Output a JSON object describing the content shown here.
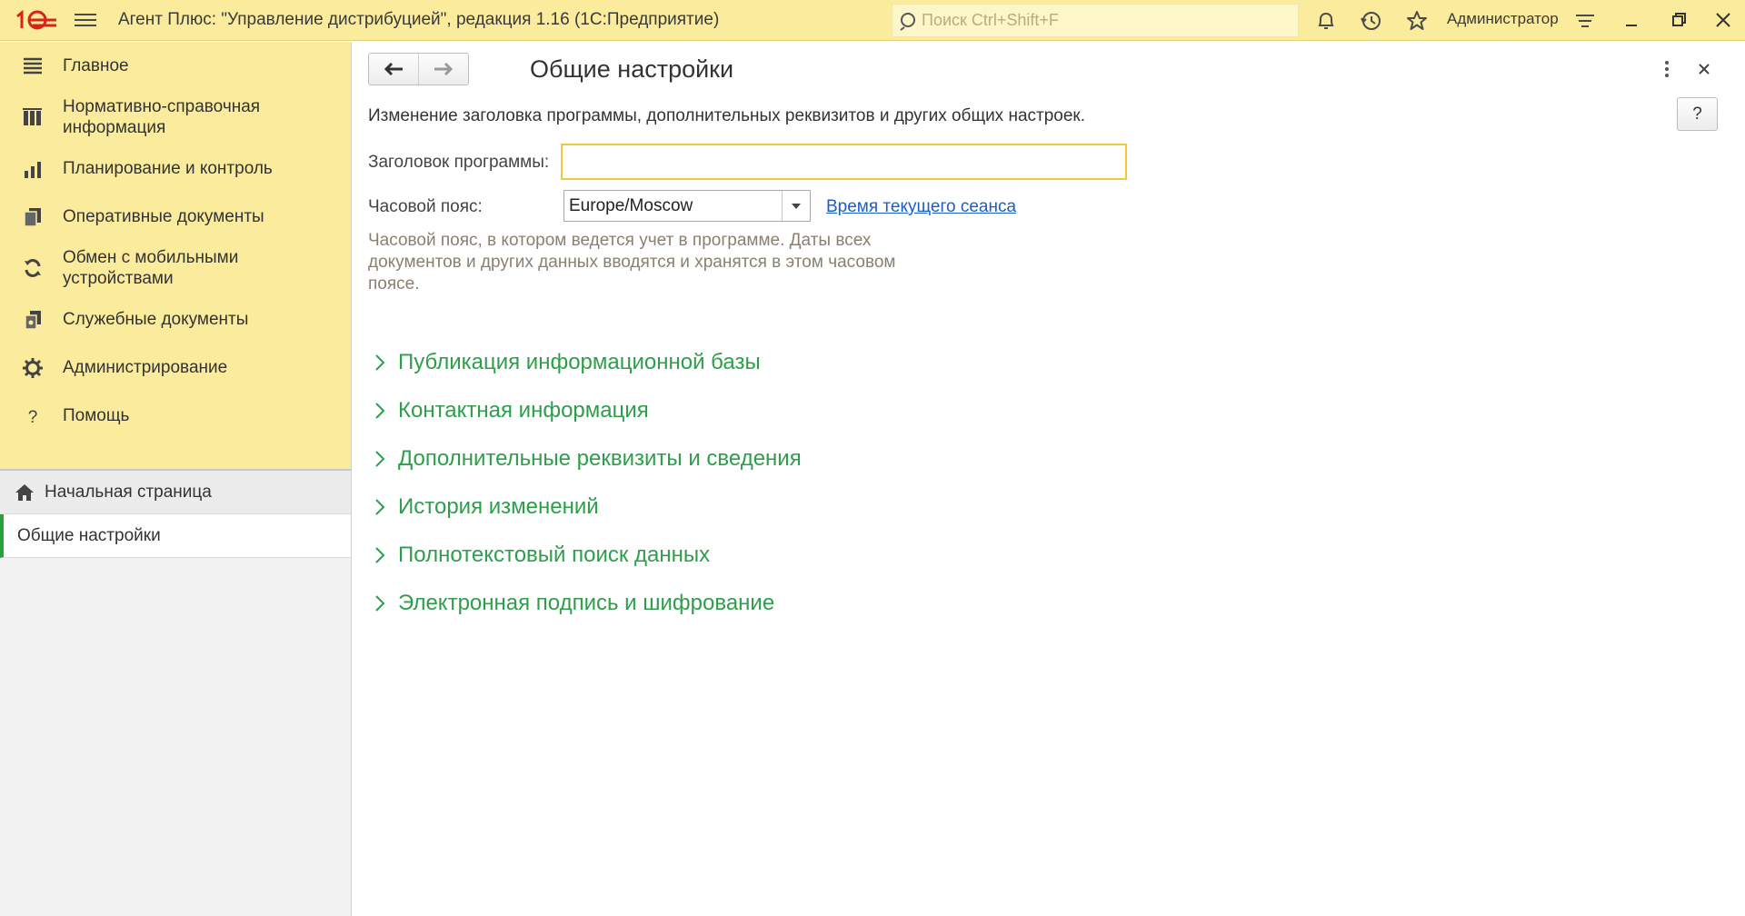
{
  "app": {
    "title": "Агент Плюс: \"Управление дистрибуцией\", редакция 1.16  (1С:Предприятие)",
    "search_placeholder": "Поиск Ctrl+Shift+F",
    "user": "Администратор",
    "accent_color": "#fbeb9d",
    "logo_color": "#d6241d",
    "icons": [
      "menu-icon",
      "bell-icon",
      "history-icon",
      "star-icon",
      "settings-lines-icon",
      "minimize-icon",
      "restore-icon",
      "close-icon"
    ]
  },
  "sidebar": {
    "items": [
      {
        "label": "Главное",
        "icon": "list-icon"
      },
      {
        "label": "Нормативно-справочная информация",
        "icon": "books-icon"
      },
      {
        "label": "Планирование и контроль",
        "icon": "bar-chart-icon"
      },
      {
        "label": "Оперативные документы",
        "icon": "documents-icon"
      },
      {
        "label": "Обмен с мобильными устройствами",
        "icon": "sync-icon"
      },
      {
        "label": "Служебные документы",
        "icon": "service-docs-icon"
      },
      {
        "label": "Администрирование",
        "icon": "gear-icon"
      },
      {
        "label": "Помощь",
        "icon": "question-icon"
      }
    ],
    "open_windows": [
      {
        "label": "Начальная страница",
        "icon": "home-icon"
      },
      {
        "label": "Общие настройки",
        "active": true
      }
    ]
  },
  "form": {
    "title": "Общие настройки",
    "help_label": "?",
    "description": "Изменение заголовка программы, дополнительных реквизитов и других общих настроек.",
    "program_title_label": "Заголовок программы:",
    "program_title_value": "",
    "timezone_label": "Часовой пояс:",
    "timezone_value": "Europe/Moscow",
    "session_time_link": "Время текущего сеанса",
    "hint": "Часовой пояс, в котором ведется учет в программе. Даты всех документов и других данных вводятся и хранятся в этом часовом поясе.",
    "group_color": "#2e9e4c",
    "groups": [
      "Публикация информационной базы",
      "Контактная информация",
      "Дополнительные реквизиты и сведения",
      "История изменений",
      "Полнотекстовый поиск данных",
      "Электронная подпись и шифрование"
    ]
  }
}
